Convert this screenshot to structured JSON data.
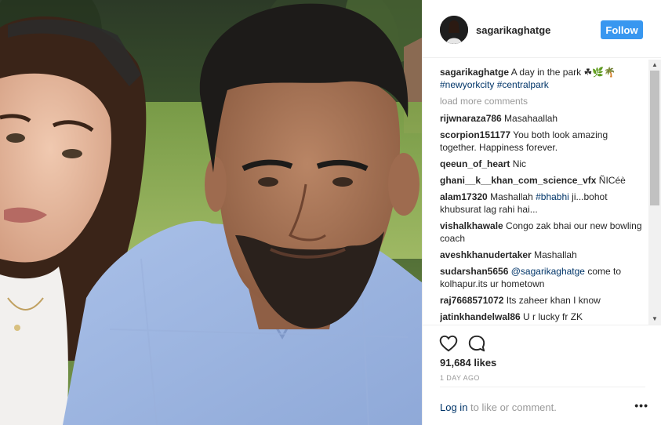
{
  "post": {
    "username": "sagarikaghatge",
    "follow_label": "Follow",
    "caption_user": "sagarikaghatge",
    "caption_text": " A day in the park ",
    "caption_emoji": "☘🌿🌴",
    "hashtags": [
      "#newyorkcity",
      "#centralpark"
    ],
    "load_more": "load more comments",
    "likes": "91,684 likes",
    "time": "1 DAY AGO",
    "login_link": "Log in",
    "login_rest": " to like or comment.",
    "more": "•••"
  },
  "comments": [
    {
      "user": "rijwnaraza786",
      "text": " Masahaallah"
    },
    {
      "user": "scorpion151177",
      "text": " You both look amazing together. Happiness forever."
    },
    {
      "user": "qeeun_of_heart",
      "text": " Nic"
    },
    {
      "user": "ghani__k__khan_com_science_vfx",
      "text": " ÑICéè"
    },
    {
      "user": "alam17320",
      "text": " Mashallah ",
      "tag": "#bhabhi",
      "text2": " ji...bohot khubsurat lag rahi hai..."
    },
    {
      "user": "vishalkhawale",
      "text": " Congo zak bhai our new bowling coach"
    },
    {
      "user": "aveshkhanudertaker",
      "text": " Mashallah"
    },
    {
      "user": "sudarshan5656",
      "text": " ",
      "tag": "@sagarikaghatge",
      "text2": " come to kolhapur.its ur hometown"
    },
    {
      "user": "raj7668571072",
      "text": " Its zaheer khan I know"
    },
    {
      "user": "jatinkhandelwal86",
      "text": " U r lucky fr ZK"
    }
  ],
  "icons": {
    "like": "heart-icon",
    "comment": "comment-bubble-icon",
    "more": "more-options-icon"
  },
  "colors": {
    "follow_button": "#3897f0",
    "link": "#003569",
    "muted": "#999999"
  }
}
